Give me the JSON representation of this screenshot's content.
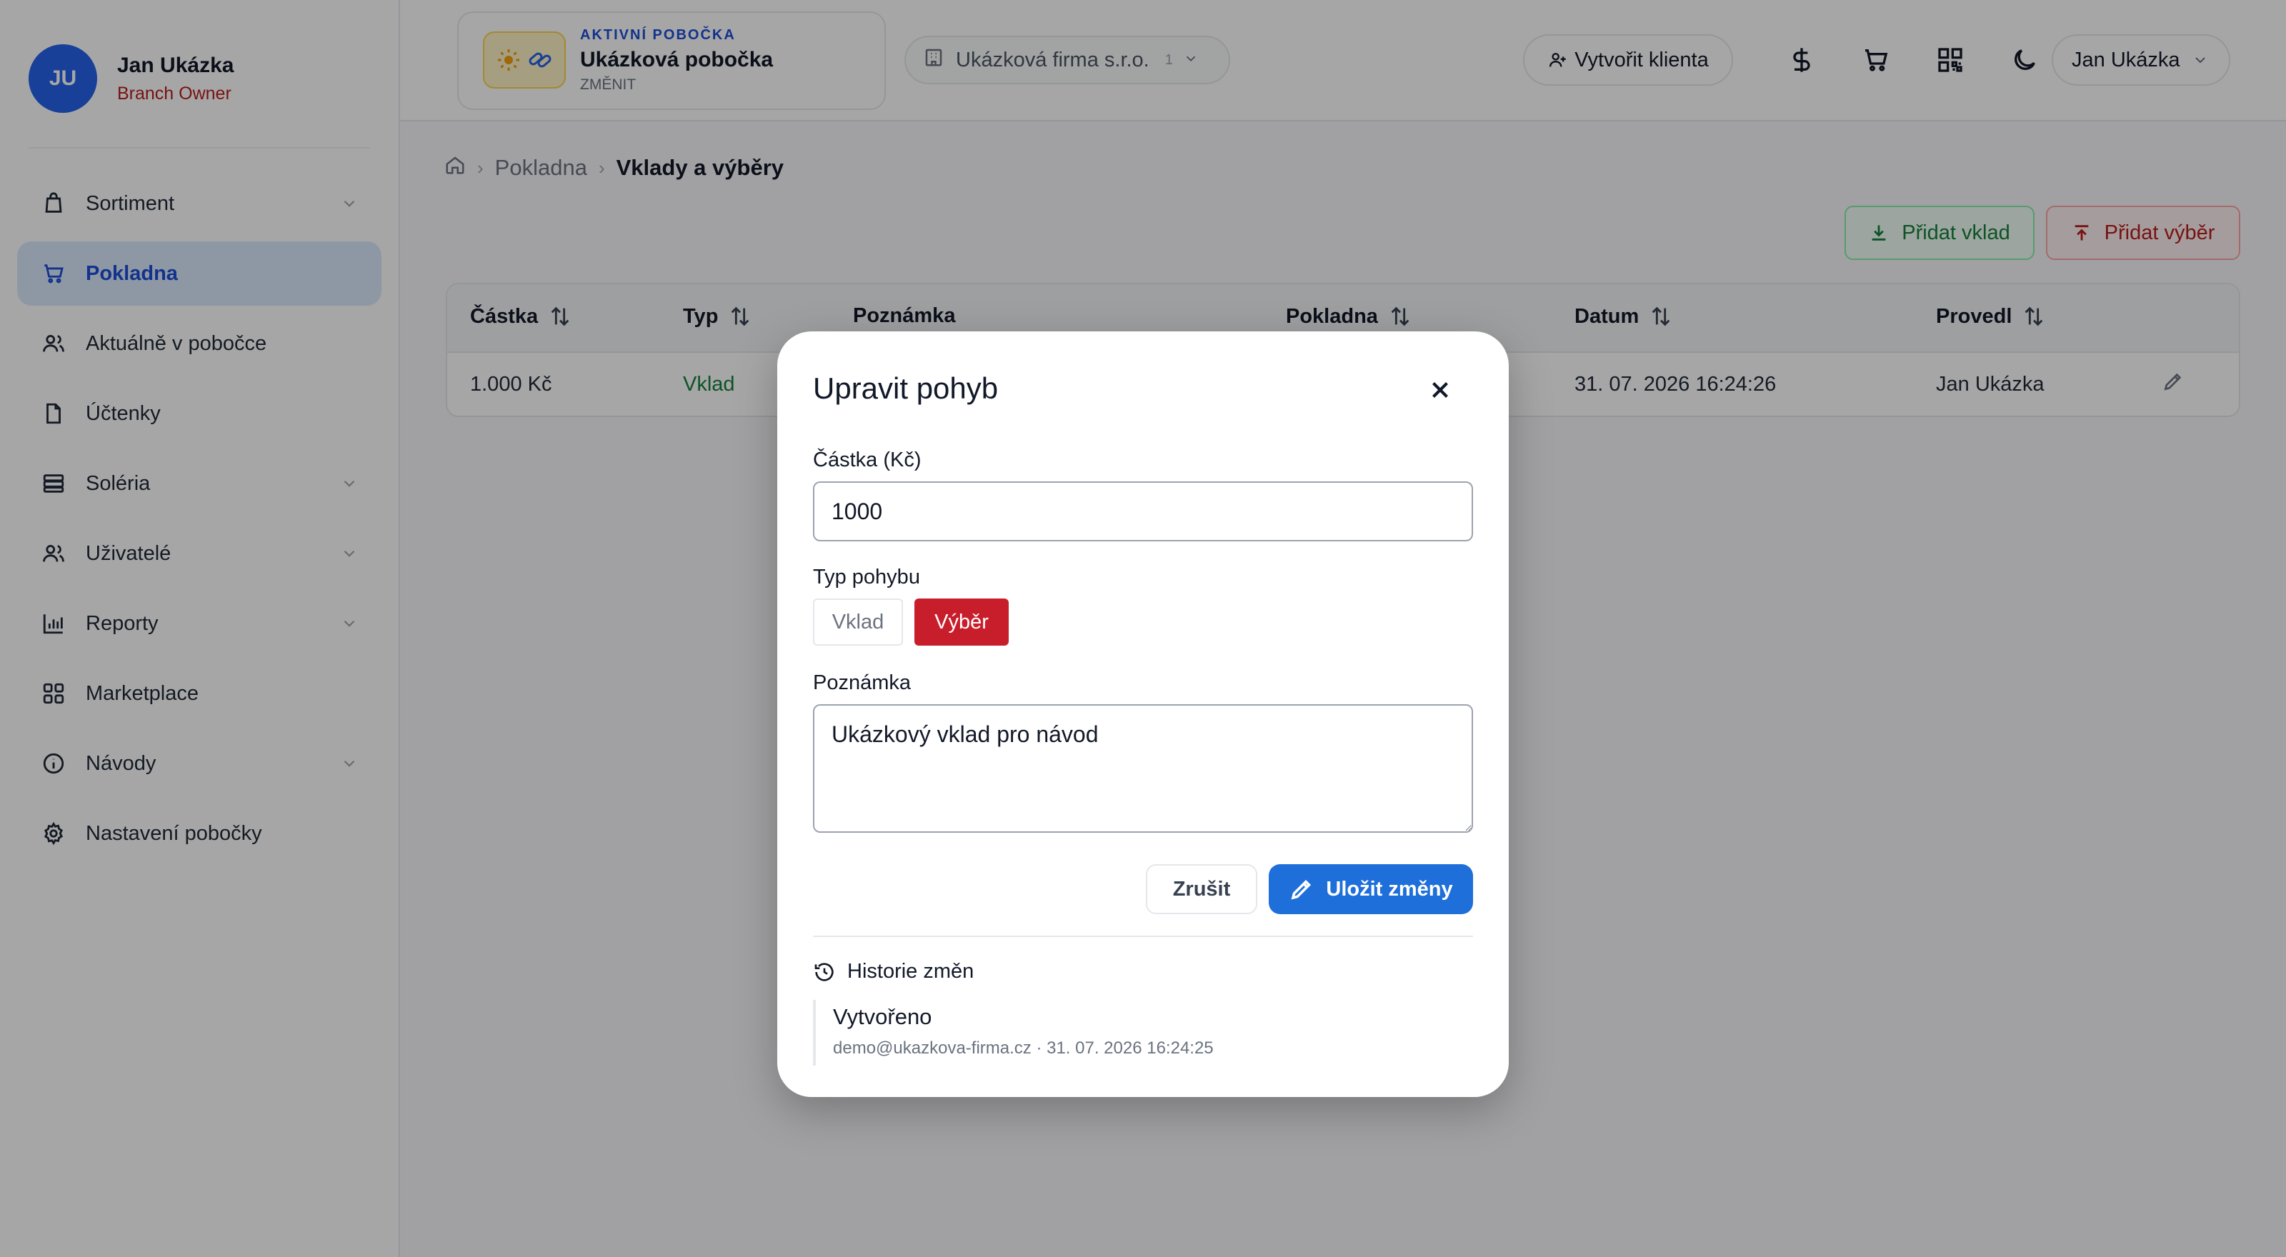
{
  "sidebar": {
    "avatar_initials": "JU",
    "user_name": "Jan Ukázka",
    "user_role": "Branch Owner",
    "items": [
      {
        "label": "Sortiment",
        "icon": "shopping-bag-icon",
        "has_submenu": true,
        "active": false
      },
      {
        "label": "Pokladna",
        "icon": "cart-icon",
        "has_submenu": false,
        "active": true
      },
      {
        "label": "Aktuálně v pobočce",
        "icon": "users-icon",
        "has_submenu": false,
        "active": false
      },
      {
        "label": "Účtenky",
        "icon": "file-icon",
        "has_submenu": false,
        "active": false
      },
      {
        "label": "Soléria",
        "icon": "server-icon",
        "has_submenu": true,
        "active": false
      },
      {
        "label": "Uživatelé",
        "icon": "users-icon",
        "has_submenu": true,
        "active": false
      },
      {
        "label": "Reporty",
        "icon": "bar-chart-icon",
        "has_submenu": true,
        "active": false
      },
      {
        "label": "Marketplace",
        "icon": "grid-icon",
        "has_submenu": false,
        "active": false
      },
      {
        "label": "Návody",
        "icon": "info-icon",
        "has_submenu": true,
        "active": false
      },
      {
        "label": "Nastavení pobočky",
        "icon": "gear-icon",
        "has_submenu": false,
        "active": false
      }
    ]
  },
  "header": {
    "branch_kicker": "AKTIVNÍ POBOČKA",
    "branch_name": "Ukázková pobočka",
    "branch_change": "ZMĚNIT",
    "company_name": "Ukázková firma s.r.o.",
    "company_count": "1",
    "create_client_label": "Vytvořit klienta",
    "user_menu_label": "Jan Ukázka"
  },
  "breadcrumb": {
    "items": [
      "Pokladna",
      "Vklady a výběry"
    ]
  },
  "actions": {
    "add_deposit": "Přidat vklad",
    "add_withdrawal": "Přidat výběr"
  },
  "table": {
    "headers": [
      "Částka",
      "Typ",
      "Poznámka",
      "Pokladna",
      "Datum",
      "Provedl"
    ],
    "rows": [
      {
        "amount": "1.000 Kč",
        "type": "Vklad",
        "note": "",
        "register": "",
        "date": "31. 07. 2026 16:24:26",
        "by": "Jan Ukázka"
      }
    ]
  },
  "modal": {
    "title": "Upravit pohyb",
    "amount_label": "Částka (Kč)",
    "amount_value": "1000",
    "type_label": "Typ pohybu",
    "type_options": [
      "Vklad",
      "Výběr"
    ],
    "type_selected": "Výběr",
    "note_label": "Poznámka",
    "note_value": "Ukázkový vklad pro návod",
    "cancel_label": "Zrušit",
    "save_label": "Uložit změny",
    "history_title": "Historie změn",
    "history": [
      {
        "title": "Vytvořeno",
        "meta": "demo@ukazkova-firma.cz · 31. 07. 2026 16:24:25"
      }
    ]
  },
  "colors": {
    "primary": "#1e6fd9",
    "danger": "#c81e2c",
    "success": "#15803d",
    "sidebar_active_bg": "#dbeafe"
  }
}
